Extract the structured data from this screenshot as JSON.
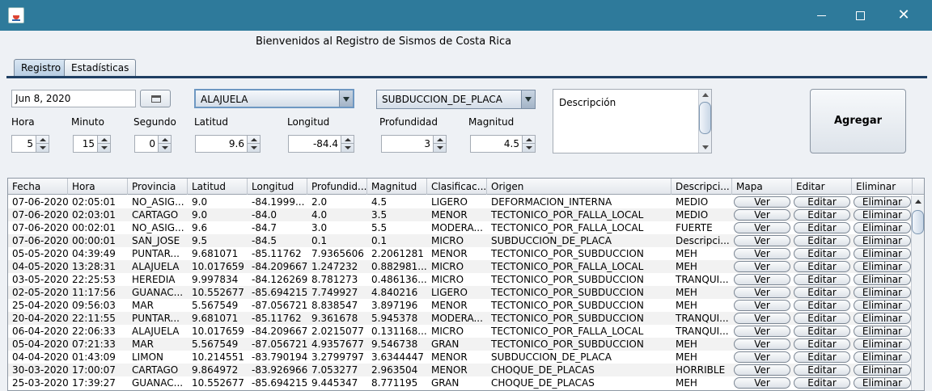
{
  "window": {
    "icon": "java-coffee-icon",
    "controls": [
      "minimize-icon",
      "maximize-icon",
      "close-icon"
    ],
    "close_glyph": "✕"
  },
  "header": {
    "welcome": "Bienvenidos al Registro de Sismos de Costa Rica"
  },
  "tabs": [
    {
      "label": "Registro",
      "active": true
    },
    {
      "label": "Estadísticas",
      "active": false
    }
  ],
  "form": {
    "date": "Jun 8, 2020",
    "provincia": "ALAJUELA",
    "origen": "SUBDUCCION_DE_PLACA",
    "descripcion_placeholder": "Descripción",
    "hora_label": "Hora",
    "hora": "5",
    "minuto_label": "Minuto",
    "minuto": "15",
    "segundo_label": "Segundo",
    "segundo": "0",
    "latitud_label": "Latitud",
    "latitud": "9.6",
    "longitud_label": "Longitud",
    "longitud": "-84.4",
    "profundidad_label": "Profundidad",
    "profundidad": "3",
    "magnitud_label": "Magnitud",
    "magnitud": "4.5",
    "agregar_label": "Agregar"
  },
  "table": {
    "columns": [
      "Fecha",
      "Hora",
      "Provincia",
      "Latitud",
      "Longitud",
      "Profundid...",
      "Magnitud",
      "Clasificac...",
      "Origen",
      "Descripci...",
      "Mapa",
      "Editar",
      "Eliminar"
    ],
    "button_labels": {
      "mapa": "Ver",
      "editar": "Editar",
      "eliminar": "Eliminar"
    },
    "rows": [
      [
        "07-06-2020",
        "02:05:01",
        "NO_ASIG...",
        "9.0",
        "-84.1999...",
        "2.0",
        "4.5",
        "LIGERO",
        "DEFORMACION_INTERNA",
        "MEDIO"
      ],
      [
        "07-06-2020",
        "02:03:01",
        "CARTAGO",
        "9.0",
        "-84.0",
        "4.0",
        "3.5",
        "MENOR",
        "TECTONICO_POR_FALLA_LOCAL",
        "MEDIO"
      ],
      [
        "07-06-2020",
        "00:02:01",
        "NO_ASIG...",
        "9.6",
        "-84.7",
        "3.0",
        "5.5",
        "MODERA...",
        "TECTONICO_POR_FALLA_LOCAL",
        "FUERTE"
      ],
      [
        "07-06-2020",
        "00:00:01",
        "SAN_JOSE",
        "9.5",
        "-84.5",
        "0.1",
        "0.1",
        "MICRO",
        "SUBDUCCION_DE_PLACA",
        "Descripci..."
      ],
      [
        "05-05-2020",
        "04:39:49",
        "PUNTAR...",
        "9.681071",
        "-85.11762",
        "7.9365606",
        "2.2061281",
        "MENOR",
        "TECTONICO_POR_SUBDUCCION",
        "MEH"
      ],
      [
        "04-05-2020",
        "13:28:31",
        "ALAJUELA",
        "10.017659",
        "-84.209667",
        "1.247232",
        "0.882981...",
        "MICRO",
        "TECTONICO_POR_FALLA_LOCAL",
        "MEH"
      ],
      [
        "03-05-2020",
        "22:25:53",
        "HEREDIA",
        "9.997834",
        "-84.126269",
        "8.781273",
        "0.486136...",
        "MICRO",
        "TECTONICO_POR_SUBDUCCION",
        "TRANQUI..."
      ],
      [
        "02-05-2020",
        "11:17:56",
        "GUANAC...",
        "10.552677",
        "-85.694215",
        "7.749927",
        "4.840216",
        "LIGERO",
        "TECTONICO_POR_SUBDUCCION",
        "MEH"
      ],
      [
        "25-04-2020",
        "09:56:03",
        "MAR",
        "5.567549",
        "-87.056721",
        "8.838547",
        "3.897196",
        "MENOR",
        "TECTONICO_POR_SUBDUCCION",
        "MEH"
      ],
      [
        "20-04-2020",
        "22:11:55",
        "PUNTAR...",
        "9.681071",
        "-85.11762",
        "9.361678",
        "5.945378",
        "MODERA...",
        "TECTONICO_POR_SUBDUCCION",
        "TRANQUI..."
      ],
      [
        "06-04-2020",
        "22:06:33",
        "ALAJUELA",
        "10.017659",
        "-84.209667",
        "2.0215077",
        "0.131168...",
        "MICRO",
        "TECTONICO_POR_FALLA_LOCAL",
        "TRANQUI..."
      ],
      [
        "05-04-2020",
        "07:21:33",
        "MAR",
        "5.567549",
        "-87.056721",
        "4.9357677",
        "9.546738",
        "GRAN",
        "TECTONICO_POR_SUBDUCCION",
        "MEH"
      ],
      [
        "04-04-2020",
        "01:43:09",
        "LIMON",
        "10.214551",
        "-83.790194",
        "3.2799797",
        "3.6344447",
        "MENOR",
        "SUBDUCCION_DE_PLACA",
        "MEH"
      ],
      [
        "30-03-2020",
        "17:00:07",
        "CARTAGO",
        "9.864972",
        "-83.926966",
        "7.053277",
        "2.963504",
        "MENOR",
        "CHOQUE_DE_PLACAS",
        "HORRIBLE"
      ],
      [
        "25-03-2020",
        "17:39:27",
        "GUANAC...",
        "10.552677",
        "-85.694215",
        "9.445347",
        "8.771195",
        "GRAN",
        "CHOQUE_DE_PLACAS",
        "MEH"
      ]
    ]
  }
}
